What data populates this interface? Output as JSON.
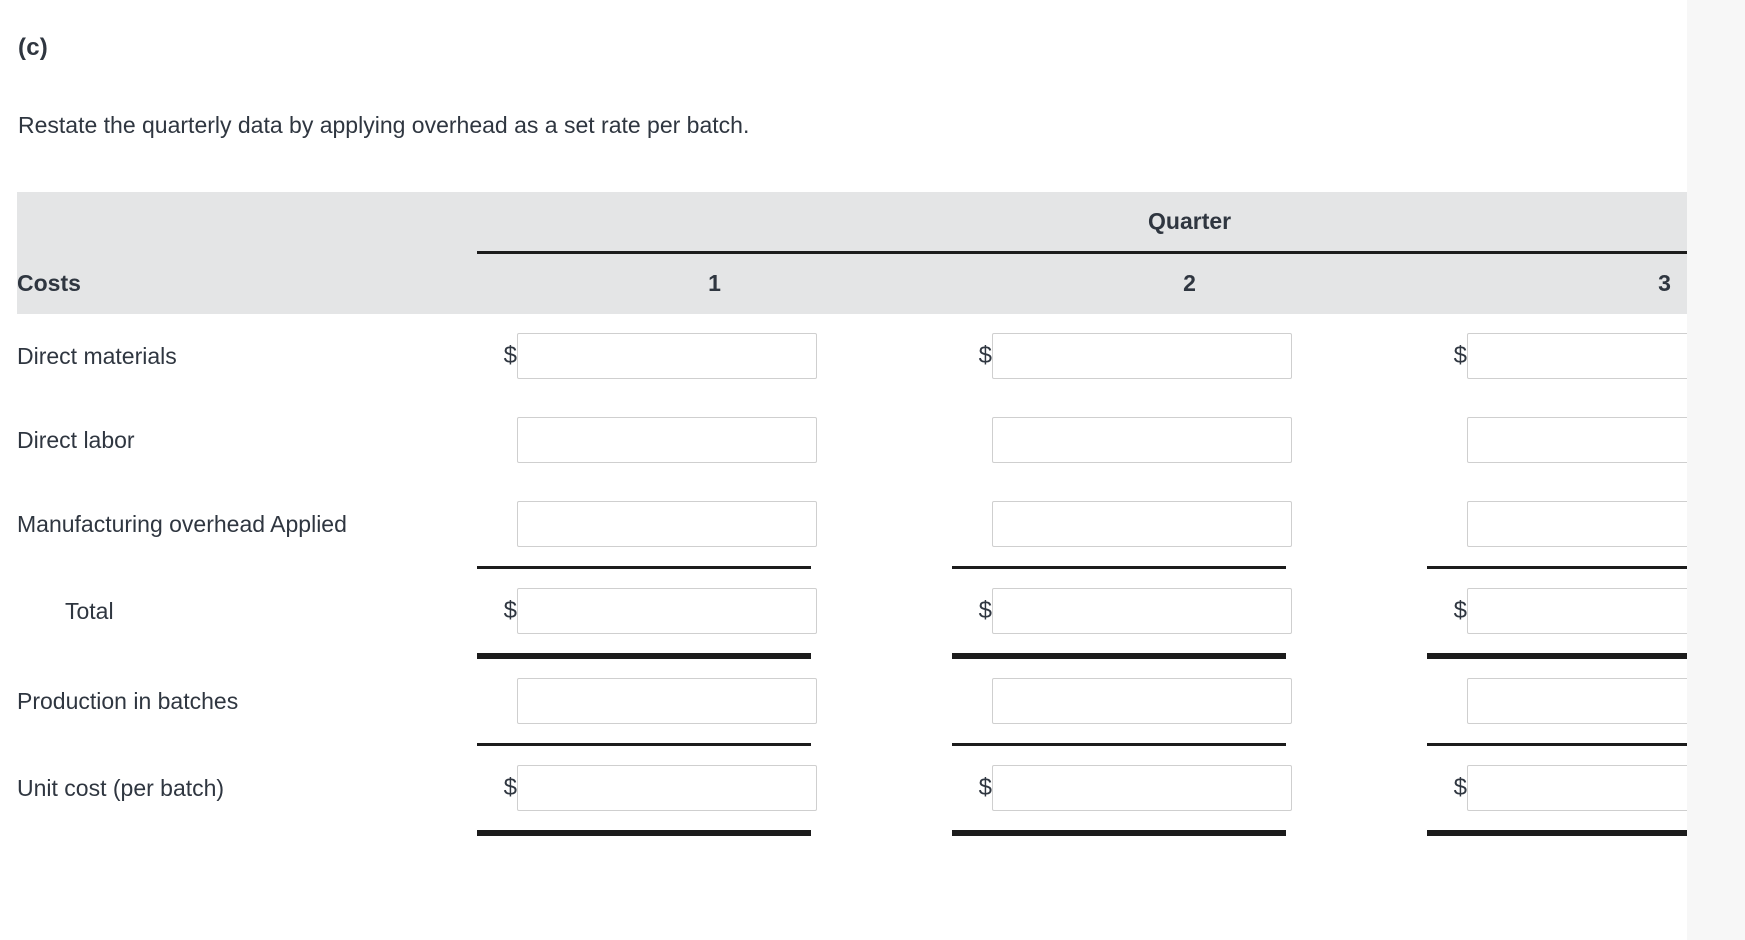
{
  "question": {
    "part_label": "(c)",
    "instruction": "Restate the quarterly data by applying overhead as a set rate per batch."
  },
  "table": {
    "group_header": "Quarter",
    "row_header_label": "Costs",
    "columns": [
      {
        "label": "1"
      },
      {
        "label": "2"
      },
      {
        "label": "3"
      }
    ],
    "currency_symbol": "$",
    "rows": [
      {
        "label": "Direct materials",
        "indent": false,
        "show_currency": true,
        "rule_above": "none",
        "rule_below": "none",
        "values": [
          "",
          "",
          ""
        ]
      },
      {
        "label": "Direct labor",
        "indent": false,
        "show_currency": false,
        "rule_above": "none",
        "rule_below": "none",
        "values": [
          "",
          "",
          ""
        ]
      },
      {
        "label": "Manufacturing overhead Applied",
        "indent": false,
        "show_currency": false,
        "rule_above": "none",
        "rule_below": "single",
        "values": [
          "",
          "",
          ""
        ]
      },
      {
        "label": "Total",
        "indent": true,
        "show_currency": true,
        "rule_above": "none",
        "rule_below": "double",
        "values": [
          "",
          "",
          ""
        ]
      },
      {
        "label": "Production in batches",
        "indent": false,
        "show_currency": false,
        "rule_above": "none",
        "rule_below": "single",
        "values": [
          "",
          "",
          ""
        ]
      },
      {
        "label": "Unit cost (per batch)",
        "indent": false,
        "show_currency": true,
        "rule_above": "none",
        "rule_below": "double",
        "values": [
          "",
          "",
          ""
        ]
      }
    ]
  },
  "colors": {
    "page_background": "#ffffff",
    "outer_background": "#f7f7f7",
    "header_band": "#e4e5e6",
    "text": "#2f3640",
    "rule": "#1c1c1c",
    "field_border": "#cfcfcf"
  }
}
